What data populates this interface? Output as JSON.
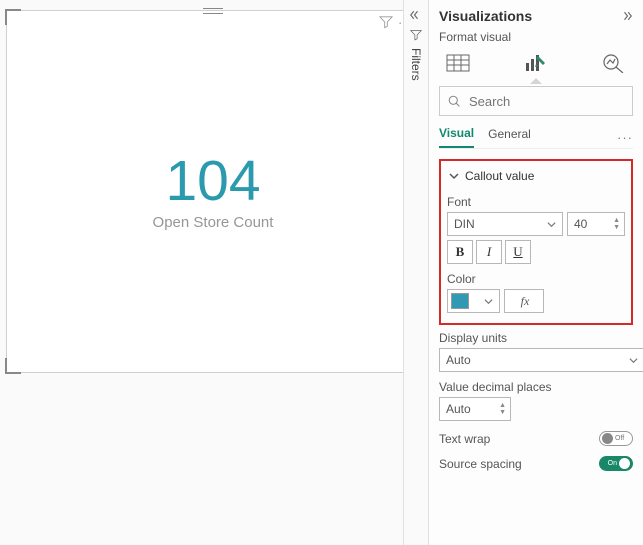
{
  "card": {
    "value": "104",
    "label": "Open Store Count"
  },
  "filters_rail": {
    "label": "Filters"
  },
  "panel": {
    "title": "Visualizations",
    "subtitle": "Format visual",
    "search_placeholder": "Search",
    "tabs": {
      "visual": "Visual",
      "general": "General"
    },
    "section_callout": "Callout value",
    "font_label": "Font",
    "font_family_value": "DIN",
    "font_size_value": "40",
    "bold_label": "B",
    "italic_label": "I",
    "underline_label": "U",
    "color_label": "Color",
    "fx_label": "fx",
    "display_units_label": "Display units",
    "display_units_value": "Auto",
    "decimal_label": "Value decimal places",
    "decimal_value": "Auto",
    "text_wrap_label": "Text wrap",
    "text_wrap_value": "Off",
    "source_spacing_label": "Source spacing",
    "source_spacing_value": "On"
  },
  "colors": {
    "callout": "#3199b3"
  },
  "chart_data": {
    "type": "card",
    "title": "Open Store Count",
    "value": 104,
    "format": {
      "font_family": "DIN",
      "font_size": 40,
      "bold": false,
      "italic": false,
      "underline": false,
      "color": "#3199b3",
      "display_units": "Auto",
      "value_decimal_places": "Auto",
      "text_wrap": false,
      "source_spacing": true
    }
  }
}
